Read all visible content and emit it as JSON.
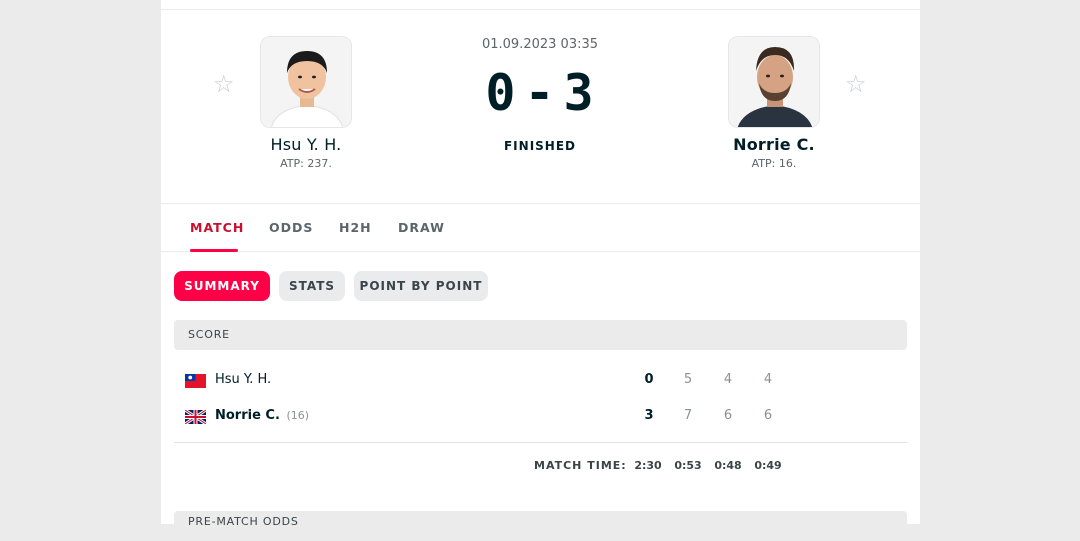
{
  "match": {
    "datetime": "01.09.2023 03:35",
    "score_home": "0",
    "score_sep": "-",
    "score_away": "3",
    "status": "FINISHED"
  },
  "home": {
    "name": "Hsu Y. H.",
    "rank": "ATP: 237.",
    "star": "☆"
  },
  "away": {
    "name": "Norrie C.",
    "rank": "ATP: 16.",
    "star": "☆"
  },
  "tabs": [
    "MATCH",
    "ODDS",
    "H2H",
    "DRAW"
  ],
  "subtabs": [
    "SUMMARY",
    "STATS",
    "POINT BY POINT"
  ],
  "score_section": {
    "title": "SCORE",
    "rows": [
      {
        "name": "Hsu Y. H.",
        "seed": "",
        "flag": "taiwan-flag-icon",
        "total": "0",
        "sets": [
          "5",
          "4",
          "4"
        ]
      },
      {
        "name": "Norrie C.",
        "seed": "(16)",
        "flag": "uk-flag-icon",
        "total": "3",
        "sets": [
          "7",
          "6",
          "6"
        ]
      }
    ],
    "match_time_label": "MATCH TIME:",
    "match_times": [
      "2:30",
      "0:53",
      "0:48",
      "0:49"
    ]
  },
  "next_section": {
    "title": "PRE-MATCH ODDS"
  },
  "colors": {
    "accent": "#ff0046",
    "tab_active": "#c8102e",
    "text": "#001e28"
  }
}
